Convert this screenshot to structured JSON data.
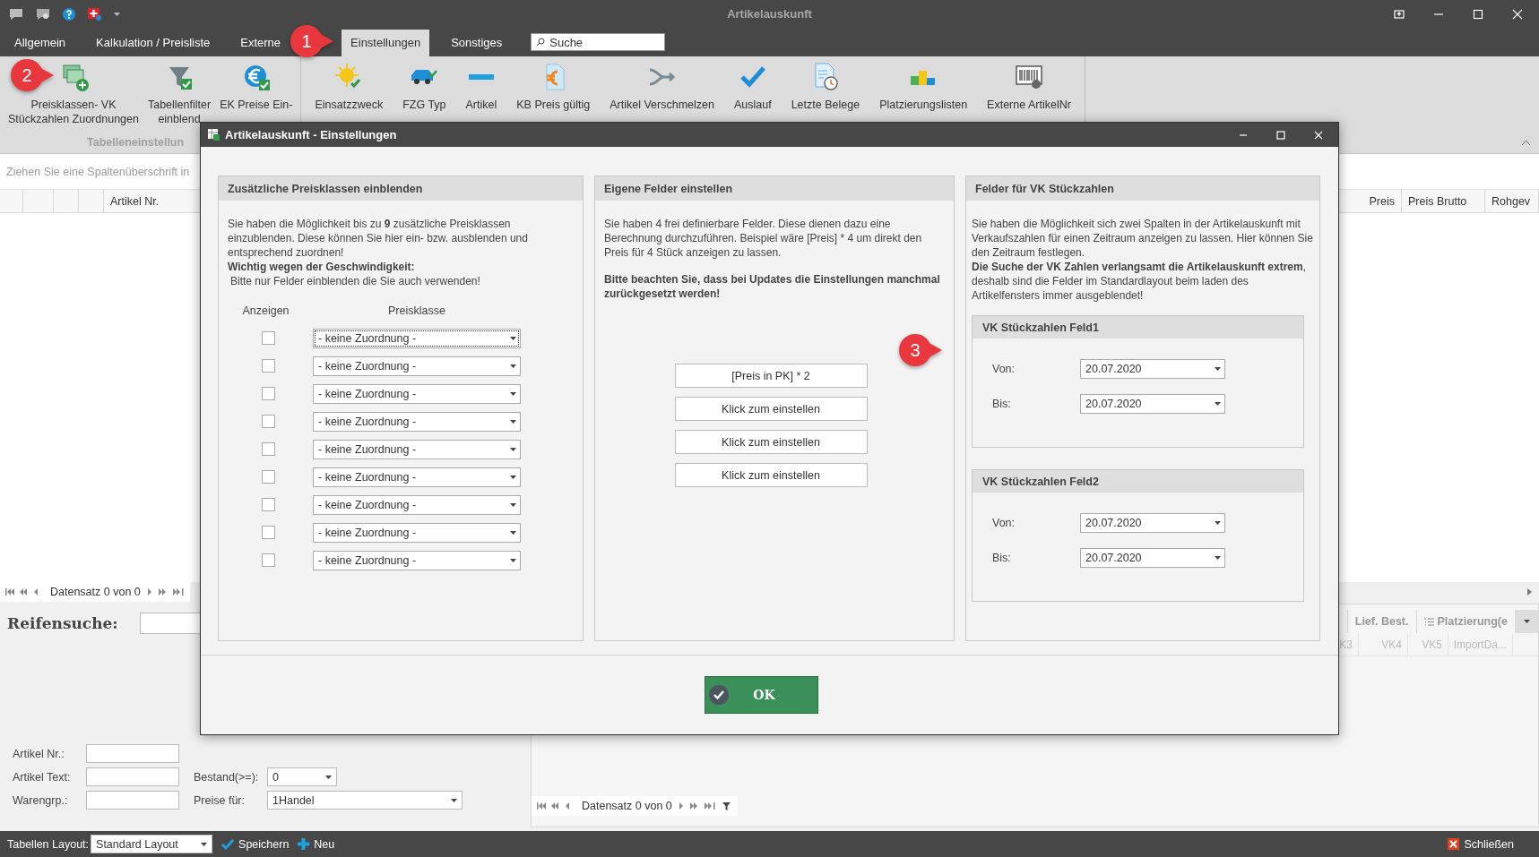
{
  "window": {
    "title": "Artikelauskunft"
  },
  "menu_tabs": [
    {
      "label": "Allgemein",
      "selected": false
    },
    {
      "label": "Kalkulation / Preisliste",
      "selected": false
    },
    {
      "label": "Externe",
      "selected": false
    },
    {
      "label": "Einstellungen",
      "selected": true
    },
    {
      "label": "Sonstiges",
      "selected": false
    }
  ],
  "search": {
    "placeholder": "Suche"
  },
  "ribbon": {
    "buttons": [
      {
        "lines": [
          "Preisklassen- VK",
          "Stückzahlen Zuordnungen"
        ]
      },
      {
        "lines": [
          "Tabellenfilter",
          "einblend"
        ]
      },
      {
        "lines": [
          "EK Preise Ein-"
        ]
      },
      {
        "lines": [
          "Einsatzzweck"
        ]
      },
      {
        "lines": [
          "FZG Typ"
        ]
      },
      {
        "lines": [
          "Artikel"
        ]
      },
      {
        "lines": [
          "KB Preis gültig"
        ]
      },
      {
        "lines": [
          "Artikel Verschmelzen"
        ]
      },
      {
        "lines": [
          "Auslauf"
        ]
      },
      {
        "lines": [
          "Letzte Belege"
        ]
      },
      {
        "lines": [
          "Platzierungslisten"
        ]
      },
      {
        "lines": [
          "Externe ArtikelNr"
        ]
      }
    ],
    "group_label": "Tabelleneinstellun"
  },
  "callouts": [
    "1",
    "2",
    "3"
  ],
  "grid": {
    "group_hint": "Ziehen Sie eine Spaltenüberschrift in",
    "columns_left": [
      "Artikel Nr."
    ],
    "columns_right": [
      "Preis",
      "Preis Brutto",
      "Rohgev"
    ],
    "navigator": "Datensatz 0 von 0"
  },
  "search_panel": {
    "title": "Reifensuche:",
    "fields": [
      {
        "label": "Artikel Nr.:"
      },
      {
        "label": "Artikel Text:"
      },
      {
        "label": "Warengrp.:"
      }
    ],
    "stock": {
      "label": "Bestand(>=):",
      "value": "0"
    },
    "prices": {
      "label": "Preise für:",
      "value": "1Handel"
    }
  },
  "detail_panel": {
    "tabs": [
      "Lief. Best.",
      "Platzierung(e"
    ],
    "columns": [
      "K3",
      "VK4",
      "VK5",
      "ImportDa..."
    ],
    "navigator": "Datensatz 0 von 0"
  },
  "status_bar": {
    "layout_label": "Tabellen Layout:",
    "layout_value": "Standard Layout",
    "save": "Speichern",
    "new": "Neu",
    "close": "Schließen"
  },
  "dialog": {
    "title": "Artikelauskunft - Einstellungen",
    "price_classes": {
      "title": "Zusätzliche Preisklassen einblenden",
      "text": "Sie haben die Möglichkeit bis zu **9** zusätzliche Preisklassen einzublenden. Diese können Sie hier ein- bzw. ausblenden und entsprechend zuordnen!",
      "warning_title": "Wichtig wegen der Geschwindigkeit:",
      "warning_text": "Bitte nur Felder einblenden die Sie auch verwenden!",
      "col_show": "Anzeigen",
      "col_class": "Preisklasse",
      "rows": [
        {
          "checked": false,
          "value": "- keine Zuordnung -",
          "focused": true
        },
        {
          "checked": false,
          "value": "- keine Zuordnung -",
          "focused": false
        },
        {
          "checked": false,
          "value": "- keine Zuordnung -",
          "focused": false
        },
        {
          "checked": false,
          "value": "- keine Zuordnung -",
          "focused": false
        },
        {
          "checked": false,
          "value": "- keine Zuordnung -",
          "focused": false
        },
        {
          "checked": false,
          "value": "- keine Zuordnung -",
          "focused": false
        },
        {
          "checked": false,
          "value": "- keine Zuordnung -",
          "focused": false
        },
        {
          "checked": false,
          "value": "- keine Zuordnung -",
          "focused": false
        },
        {
          "checked": false,
          "value": "- keine Zuordnung -",
          "focused": false
        }
      ]
    },
    "custom_fields": {
      "title": "Eigene Felder einstellen",
      "text": "Sie haben 4 frei definierbare Felder. Diese dienen dazu eine Berechnung durchzuführen. Beispiel wäre [Preis] * 4 um direkt den Preis für 4 Stück anzeigen zu lassen.",
      "note": "Bitte beachten Sie, dass bei Updates die Einstellungen manchmal zurückgesetzt werden!",
      "buttons": [
        "[Preis in PK] * 2",
        "Klick zum einstellen",
        "Klick zum einstellen",
        "Klick zum einstellen"
      ]
    },
    "sales_fields": {
      "title": "Felder für VK Stückzahlen",
      "text": "Sie haben die Möglichkeit sich zwei Spalten in der Artikelauskunft mit Verkaufszahlen für einen Zeitraum anzeigen zu lassen. Hier können Sie den Zeitraum festlegen.",
      "warning": "**Die Suche der VK Zahlen verlangsamt die Artikelauskunft extrem**, deshalb sind die Felder im Standardlayout beim laden des Artikelfensters immer ausgeblendet!",
      "groups": [
        {
          "title": "VK Stückzahlen Feld1",
          "from_label": "Von:",
          "from": "20.07.2020",
          "to_label": "Bis:",
          "to": "20.07.2020"
        },
        {
          "title": "VK Stückzahlen Feld2",
          "from_label": "Von:",
          "from": "20.07.2020",
          "to_label": "Bis:",
          "to": "20.07.2020"
        }
      ]
    },
    "ok_button": "OK"
  }
}
